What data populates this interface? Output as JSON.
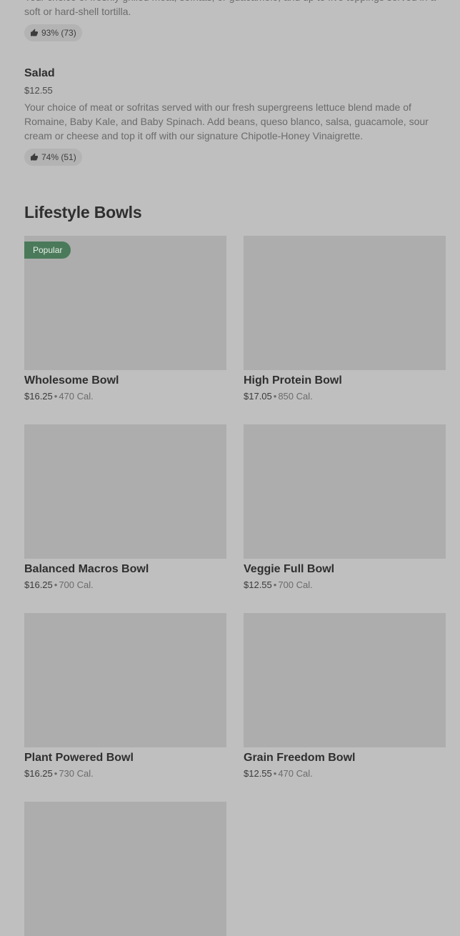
{
  "previous_item": {
    "description": "Your choice of freshly grilled meat, sofritas, or guacamole, and up to five toppings served in a soft or hard-shell tortilla.",
    "rating": "93% (73)"
  },
  "salad_item": {
    "name": "Salad",
    "price": "$12.55",
    "description": "Your choice of meat or sofritas served with our fresh supergreens lettuce blend made of Romaine, Baby Kale, and Baby Spinach. Add beans, queso blanco, salsa, guacamole, sour cream or cheese and top it off with our signature Chipotle-Honey Vinaigrette.",
    "rating": "74% (51)"
  },
  "section": {
    "title": "Lifestyle Bowls",
    "separator": "•",
    "cards": [
      {
        "name": "Wholesome Bowl",
        "price": "$16.25",
        "calories": "470 Cal.",
        "badge": "Popular"
      },
      {
        "name": "High Protein Bowl",
        "price": "$17.05",
        "calories": "850 Cal."
      },
      {
        "name": "Balanced Macros Bowl",
        "price": "$16.25",
        "calories": "700 Cal."
      },
      {
        "name": "Veggie Full Bowl",
        "price": "$12.55",
        "calories": "700 Cal."
      },
      {
        "name": "Plant Powered Bowl",
        "price": "$16.25",
        "calories": "730 Cal."
      },
      {
        "name": "Grain Freedom Bowl",
        "price": "$12.55",
        "calories": "470 Cal."
      },
      {
        "name": "",
        "price": "",
        "calories": ""
      }
    ]
  },
  "colors": {
    "background": "#bfbfbf",
    "image_placeholder": "#adadad",
    "popular_badge": "#4a7a5a"
  }
}
